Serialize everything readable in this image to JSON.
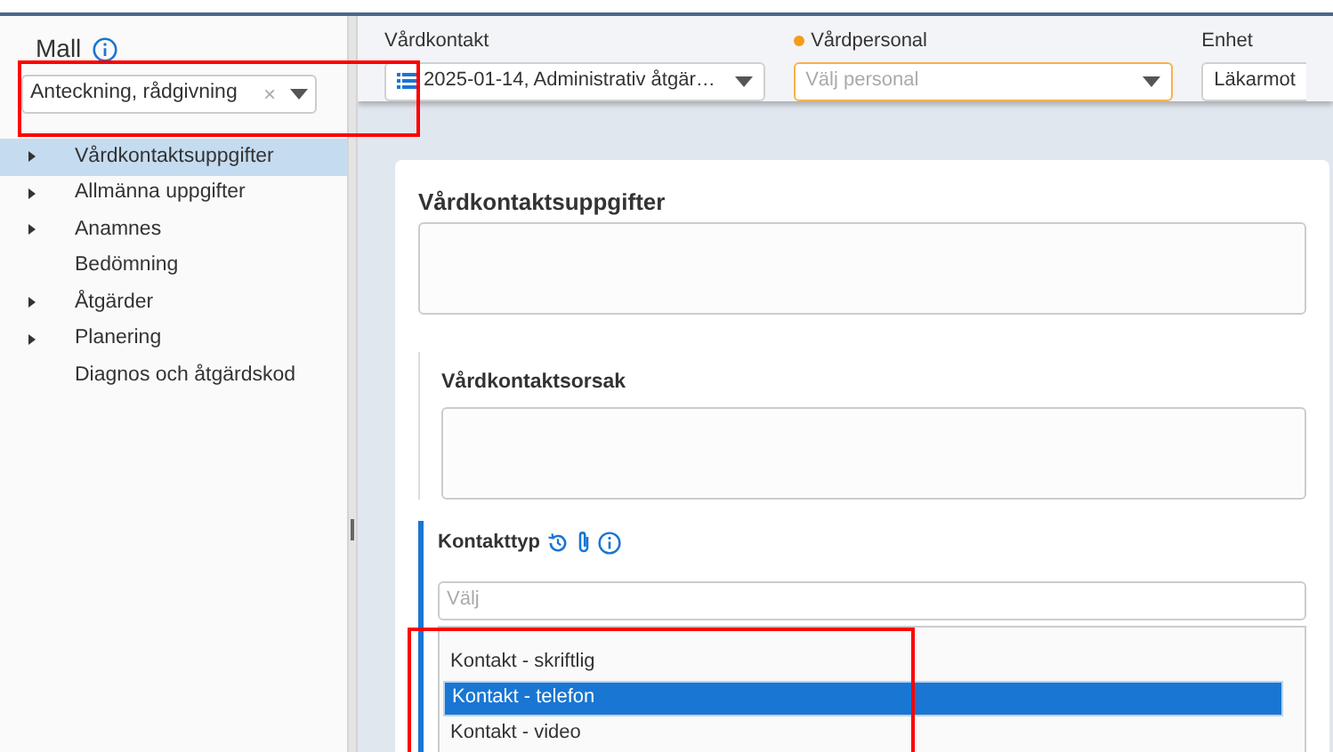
{
  "sidebar": {
    "title": "Mall",
    "template": {
      "value": "Anteckning, rådgivning",
      "clear": "×"
    },
    "items": [
      {
        "label": "Vårdkontaktsuppgifter",
        "expandable": true,
        "selected": true
      },
      {
        "label": "Allmänna uppgifter",
        "expandable": true,
        "selected": false
      },
      {
        "label": "Anamnes",
        "expandable": true,
        "selected": false
      },
      {
        "label": "Bedömning",
        "expandable": false,
        "selected": false
      },
      {
        "label": "Åtgärder",
        "expandable": true,
        "selected": false
      },
      {
        "label": "Planering",
        "expandable": true,
        "selected": false
      },
      {
        "label": "Diagnos och åtgärdskod",
        "expandable": false,
        "selected": false
      }
    ]
  },
  "header": {
    "fields": [
      {
        "label": "Vårdkontakt",
        "value": "2025-01-14, Administrativ åtgär…",
        "required": false
      },
      {
        "label": "Vårdpersonal",
        "placeholder": "Välj personal",
        "required": true
      },
      {
        "label": "Enhet",
        "value": "Läkarmot",
        "required": false
      }
    ]
  },
  "form": {
    "title": "Vårdkontaktsuppgifter",
    "subsection": "Vårdkontaktsorsak",
    "contact_type": {
      "label": "Kontakttyp",
      "placeholder": "Välj",
      "options": [
        {
          "label": "Kontakt - skriftlig",
          "selected": false
        },
        {
          "label": "Kontakt - telefon",
          "selected": true
        },
        {
          "label": "Kontakt - video",
          "selected": false
        }
      ]
    }
  }
}
